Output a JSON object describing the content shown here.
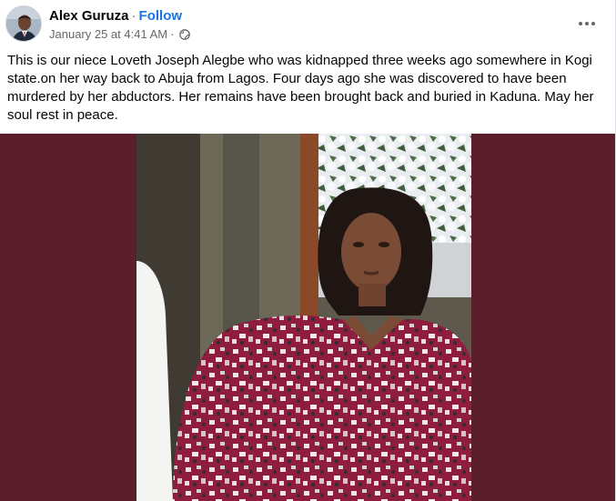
{
  "post": {
    "author": {
      "name": "Alex Guruza",
      "separator": "·",
      "follow_label": "Follow"
    },
    "meta": {
      "timestamp": "January 25 at 4:41 AM",
      "separator": "·",
      "audience_icon": "globe-icon"
    },
    "more_icon": "more-horizontal-icon",
    "caption": "This is our niece Loveth Joseph Alegbe who was kidnapped three weeks ago somewhere in Kogi state.on her way back to Abuja from Lagos. Four days ago she was discovered to have been murdered by her abductors. Her remains have been brought back and buried in Kaduna. May her soul rest in peace.",
    "photo": {
      "alt": "Photo",
      "background_color": "#5b1f2c"
    }
  },
  "colors": {
    "link_blue": "#1b74e4",
    "text_primary": "#050505",
    "text_secondary": "#65676b",
    "photo_letterbox": "#5b1f2c"
  }
}
